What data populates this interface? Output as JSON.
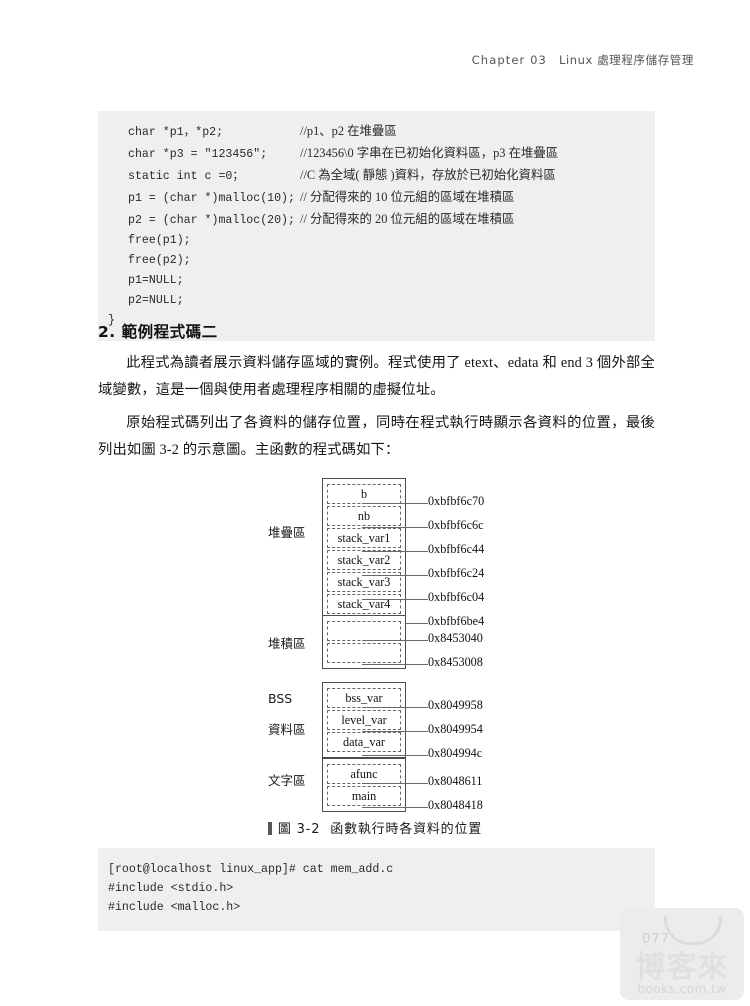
{
  "header": {
    "chapter_en": "Chapter 03",
    "chapter_cn": "Linux 處理程序儲存管理"
  },
  "top_code_block": {
    "lines": [
      {
        "code": "char *p1，*p2;",
        "comment": "//p1、p2 在堆疊區"
      },
      {
        "code": "char *p3 = \"123456\";",
        "comment": "//123456\\0 字串在已初始化資料區，p3 在堆疊區"
      },
      {
        "code": "static int c =0；",
        "comment": "//C 為全域( 靜態 )資料，存放於已初始化資料區"
      },
      {
        "code": "p1 = (char *)malloc(10);",
        "comment": "// 分配得來的 10 位元組的區域在堆積區"
      },
      {
        "code": "p2 = (char *)malloc(20);",
        "comment": "// 分配得來的 20 位元組的區域在堆積區"
      },
      {
        "code": "free(p1);",
        "comment": ""
      },
      {
        "code": "free(p2);",
        "comment": ""
      },
      {
        "code": "p1=NULL;",
        "comment": ""
      },
      {
        "code": "p2=NULL;",
        "comment": ""
      }
    ],
    "closing_brace": "}"
  },
  "section": {
    "heading": "2. 範例程式碼二",
    "paragraph_1": "此程式為讀者展示資料儲存區域的實例。程式使用了 etext、edata 和 end 3 個外部全域變數，這是一個與使用者處理程序相關的虛擬位址。",
    "paragraph_2": "原始程式碼列出了各資料的儲存位置，同時在程式執行時顯示各資料的位置，最後列出如圖 3-2 的示意圖。主函數的程式碼如下："
  },
  "figure": {
    "caption_marker": "圖 3-2",
    "caption_text": "函數執行時各資料的位置",
    "regions": [
      {
        "label": "堆疊區",
        "label2": "",
        "cells": [
          {
            "name": "b",
            "addr": "0xbfbf6c70"
          },
          {
            "name": "nb",
            "addr": "0xbfbf6c6c"
          },
          {
            "name": "stack_var1",
            "addr": "0xbfbf6c44"
          },
          {
            "name": "stack_var2",
            "addr": "0xbfbf6c24"
          },
          {
            "name": "stack_var3",
            "addr": "0xbfbf6c04"
          },
          {
            "name": "stack_var4",
            "addr": "0xbfbf6be4"
          }
        ]
      },
      {
        "label": "堆積區",
        "label2": "",
        "cells": [
          {
            "name": "",
            "addr": "0x8453040"
          },
          {
            "name": "",
            "addr": "0x8453008"
          }
        ]
      },
      {
        "label": "BSS",
        "label2": "資料區",
        "cells": [
          {
            "name": "bss_var",
            "addr": "0x8049958"
          },
          {
            "name": "level_var",
            "addr": "0x8049954"
          },
          {
            "name": "data_var",
            "addr": "0x804994c"
          }
        ]
      },
      {
        "label": "文字區",
        "label2": "",
        "cells": [
          {
            "name": "afunc",
            "addr": "0x8048611"
          },
          {
            "name": "main",
            "addr": "0x8048418"
          }
        ]
      }
    ]
  },
  "bottom_code_block": {
    "lines": [
      "[root@localhost linux_app]# cat mem_add.c",
      "#include <stdio.h>",
      "#include <malloc.h>"
    ]
  },
  "watermark": {
    "page_number": "077",
    "brand_cn": "博客來",
    "brand_url": "books.com.tw"
  }
}
